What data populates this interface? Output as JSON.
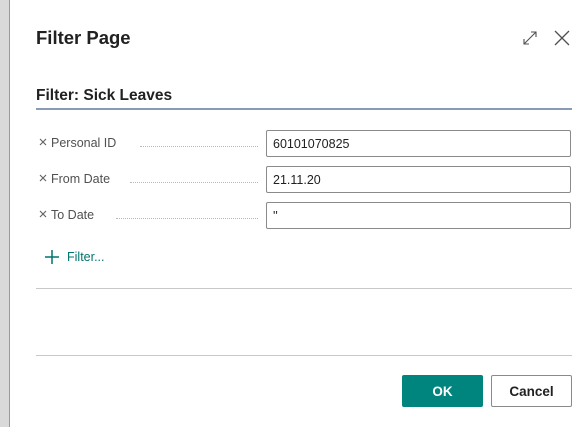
{
  "dialog": {
    "title": "Filter Page",
    "expand_icon": "expand-icon",
    "close_icon": "close-icon"
  },
  "filter_section": {
    "title": "Filter: Sick Leaves",
    "fields": [
      {
        "label": "Personal ID",
        "value": "60101070825",
        "remove_icon": "x-icon"
      },
      {
        "label": "From Date",
        "value": "21.11.20",
        "remove_icon": "x-icon"
      },
      {
        "label": "To Date",
        "value": "''",
        "remove_icon": "x-icon"
      }
    ],
    "add_filter_label": "Filter...",
    "add_filter_icon": "plus-icon"
  },
  "footer": {
    "ok_label": "OK",
    "cancel_label": "Cancel"
  },
  "colors": {
    "accent": "#00847e",
    "link": "#00746e",
    "section_rule": "#8a9bb8"
  }
}
